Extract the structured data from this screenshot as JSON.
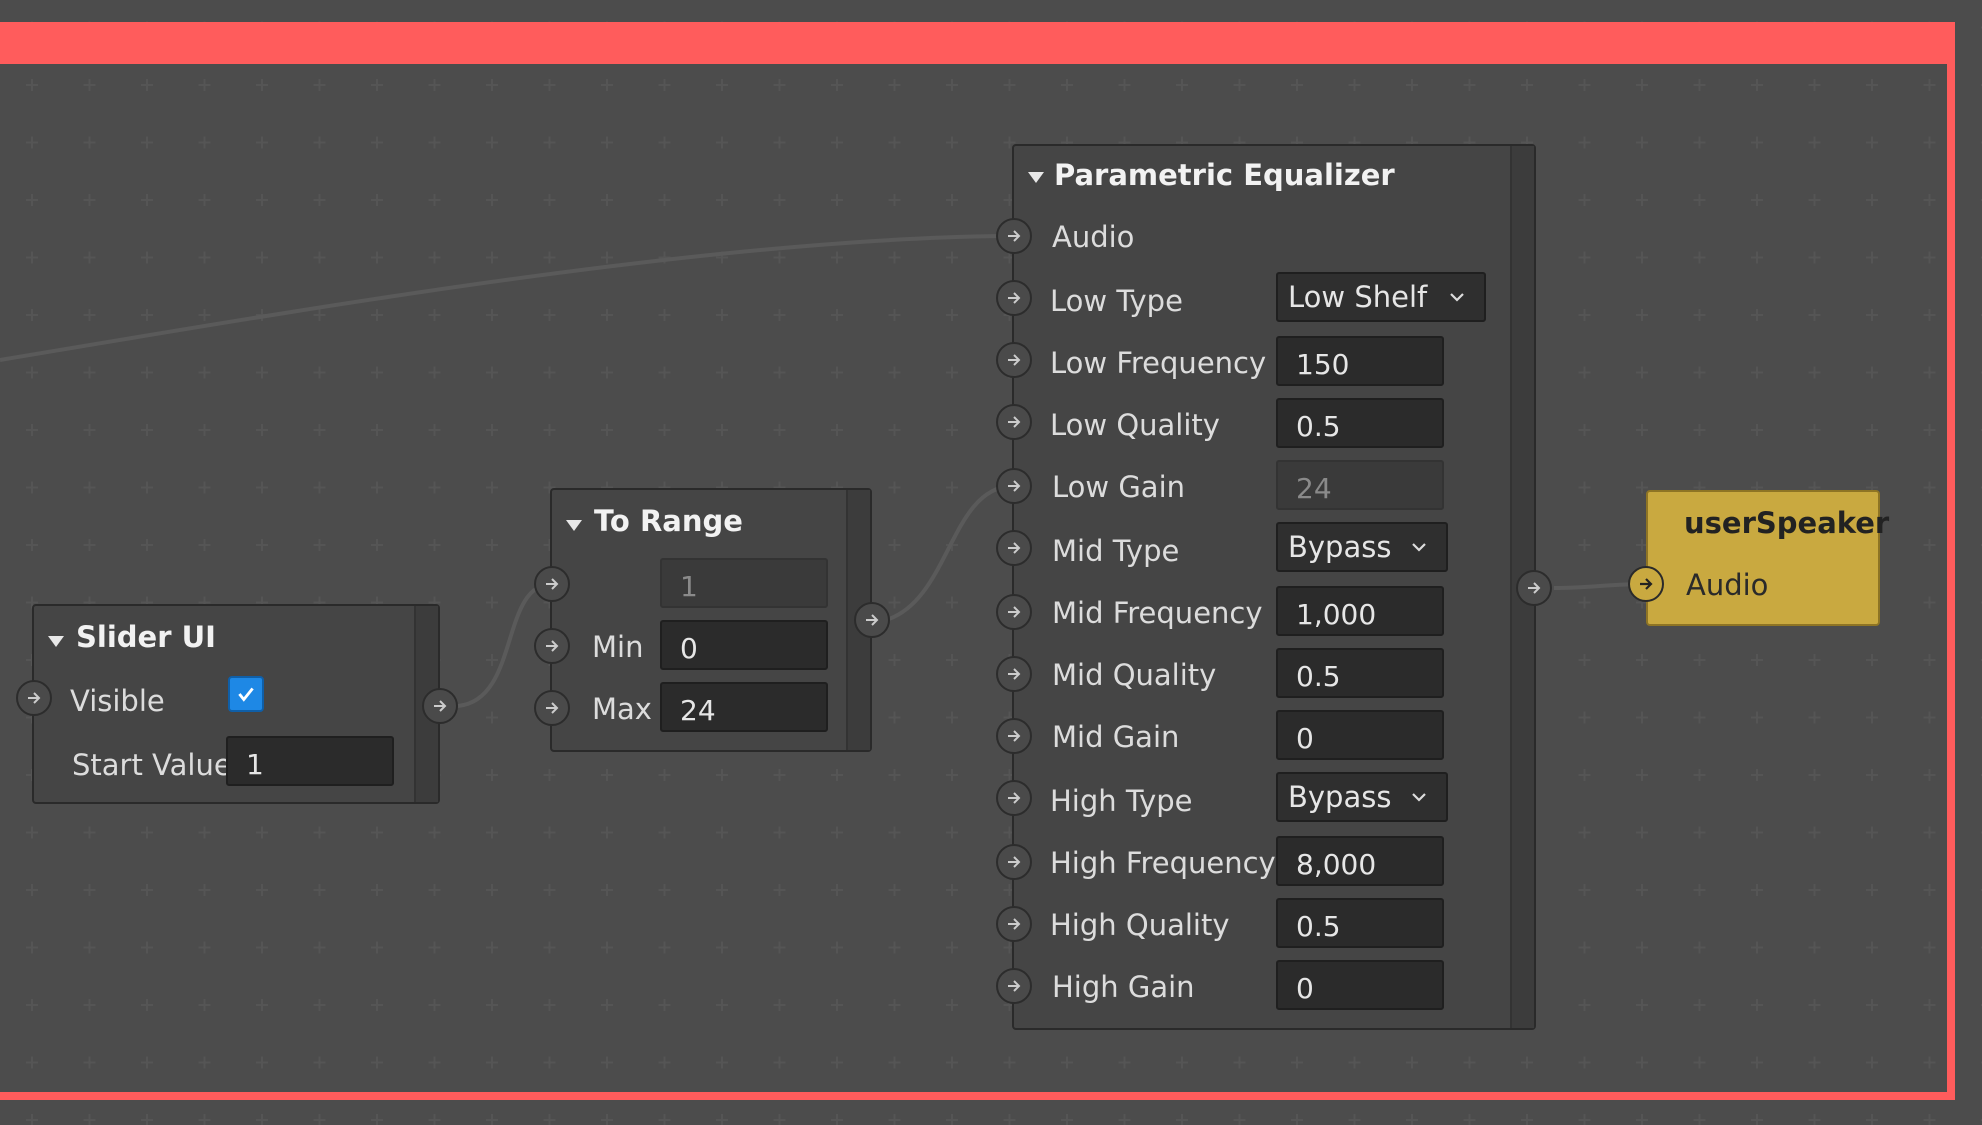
{
  "colors": {
    "frame_border": "#ff5c5c",
    "canvas_bg": "#353535",
    "node_bg": "#454545",
    "output_node_bg": "#c9a940",
    "checkbox_accent": "#1e88e5"
  },
  "slider_node": {
    "title": "Slider UI",
    "visible_label": "Visible",
    "visible_checked": true,
    "start_value_label": "Start Value",
    "start_value": "1"
  },
  "to_range_node": {
    "title": "To Range",
    "input_value": "1",
    "min_label": "Min",
    "min_value": "0",
    "max_label": "Max",
    "max_value": "24"
  },
  "eq_node": {
    "title": "Parametric Equalizer",
    "audio_label": "Audio",
    "low_type_label": "Low Type",
    "low_type_value": "Low Shelf",
    "low_frequency_label": "Low Frequency",
    "low_frequency_value": "150",
    "low_quality_label": "Low Quality",
    "low_quality_value": "0.5",
    "low_gain_label": "Low Gain",
    "low_gain_value": "24",
    "mid_type_label": "Mid Type",
    "mid_type_value": "Bypass",
    "mid_frequency_label": "Mid Frequency",
    "mid_frequency_value": "1,000",
    "mid_quality_label": "Mid Quality",
    "mid_quality_value": "0.5",
    "mid_gain_label": "Mid Gain",
    "mid_gain_value": "0",
    "high_type_label": "High Type",
    "high_type_value": "Bypass",
    "high_frequency_label": "High Frequency",
    "high_frequency_value": "8,000",
    "high_quality_label": "High Quality",
    "high_quality_value": "0.5",
    "high_gain_label": "High Gain",
    "high_gain_value": "0"
  },
  "speaker_node": {
    "title": "userSpeaker",
    "audio_label": "Audio"
  },
  "icons": {
    "port": "arrow-right-icon",
    "collapse": "triangle-down-icon",
    "dropdown": "chevron-down-icon",
    "check": "checkmark-icon"
  }
}
